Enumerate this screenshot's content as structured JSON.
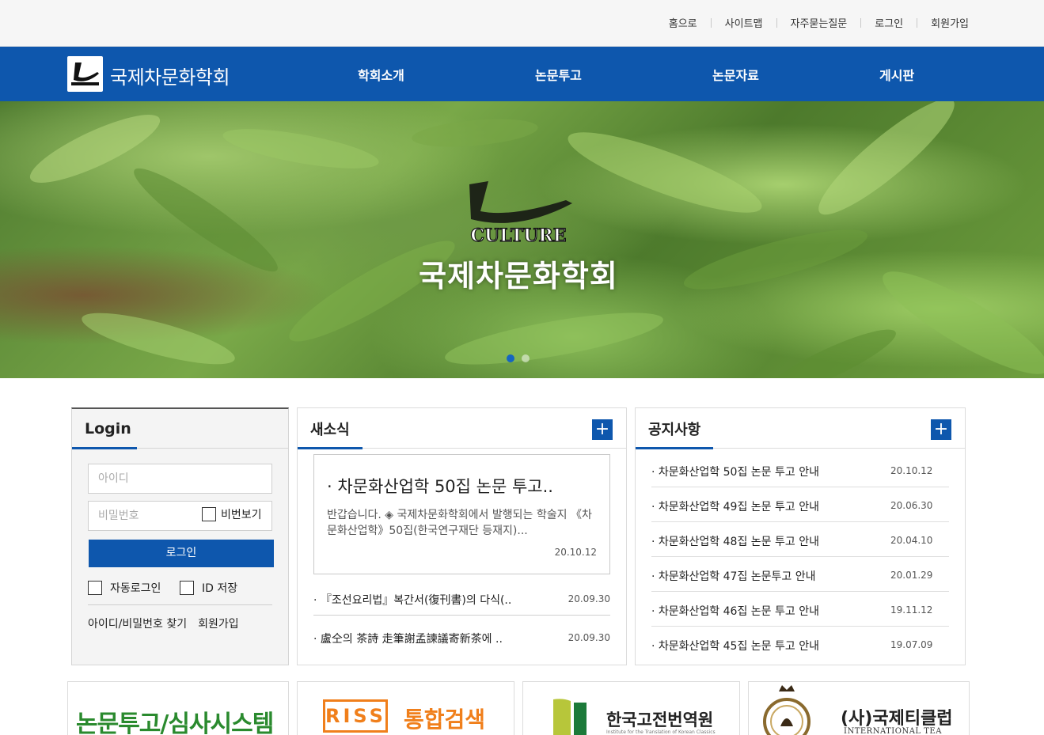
{
  "top_links": [
    "홈으로",
    "사이트맵",
    "자주묻는질문",
    "로그인",
    "회원가입"
  ],
  "site": {
    "title": "국제차문화학회"
  },
  "nav": {
    "items": [
      "학회소개",
      "논문투고",
      "논문자료",
      "게시판"
    ]
  },
  "hero": {
    "logo_text": "CULTURE",
    "title": "국제차문화학회",
    "slides": 2,
    "active_slide": 1
  },
  "login": {
    "title": "Login",
    "id_placeholder": "아이디",
    "pw_placeholder": "비밀번호",
    "show_pw": "비번보기",
    "button": "로그인",
    "auto_login": "자동로그인",
    "save_id": "ID 저장",
    "find_link": "아이디/비밀번호 찾기",
    "join_link": "회원가입"
  },
  "news": {
    "title": "새소식",
    "more": "+",
    "featured": {
      "title": "· 차문화산업학 50집 논문 투고..",
      "body": "반갑습니다. ◈ 국제차문화학회에서 발행되는 학술지 《차문화산업학》50집(한국연구재단 등재지)...",
      "date": "20.10.12"
    },
    "items": [
      {
        "title": "· 『조선요리법』복간서(復刊書)의 다식(..",
        "date": "20.09.30"
      },
      {
        "title": "· 盧仝의 茶詩 走筆謝孟諫議寄新茶에 ..",
        "date": "20.09.30"
      }
    ]
  },
  "notice": {
    "title": "공지사항",
    "more": "+",
    "items": [
      {
        "title": "· 차문화산업학 50집 논문 투고 안내",
        "date": "20.10.12"
      },
      {
        "title": "· 차문화산업학 49집 논문 투고 안내",
        "date": "20.06.30"
      },
      {
        "title": "· 차문화산업학 48집 논문 투고 안내",
        "date": "20.04.10"
      },
      {
        "title": "· 차문화산업학 47집 논문투고 안내",
        "date": "20.01.29"
      },
      {
        "title": "· 차문화산업학 46집 논문 투고 안내",
        "date": "19.11.12"
      },
      {
        "title": "· 차문화산업학 45집 논문 투고 안내",
        "date": "19.07.09"
      }
    ]
  },
  "banners": {
    "review_system": "논문투고/심사시스템",
    "riss_logo": "RISS",
    "riss_text": "통합검색",
    "classics": "한국고전번역원",
    "classics_sub": "Institute for the Translation of Korean Classics",
    "tea_club": "(사)국제티클럽",
    "tea_club_sub": "INTERNATIONAL TEA CLUB"
  },
  "colors": {
    "brand_blue": "#0e57ad",
    "green": "#2a8a2e",
    "orange": "#f07f1b"
  }
}
